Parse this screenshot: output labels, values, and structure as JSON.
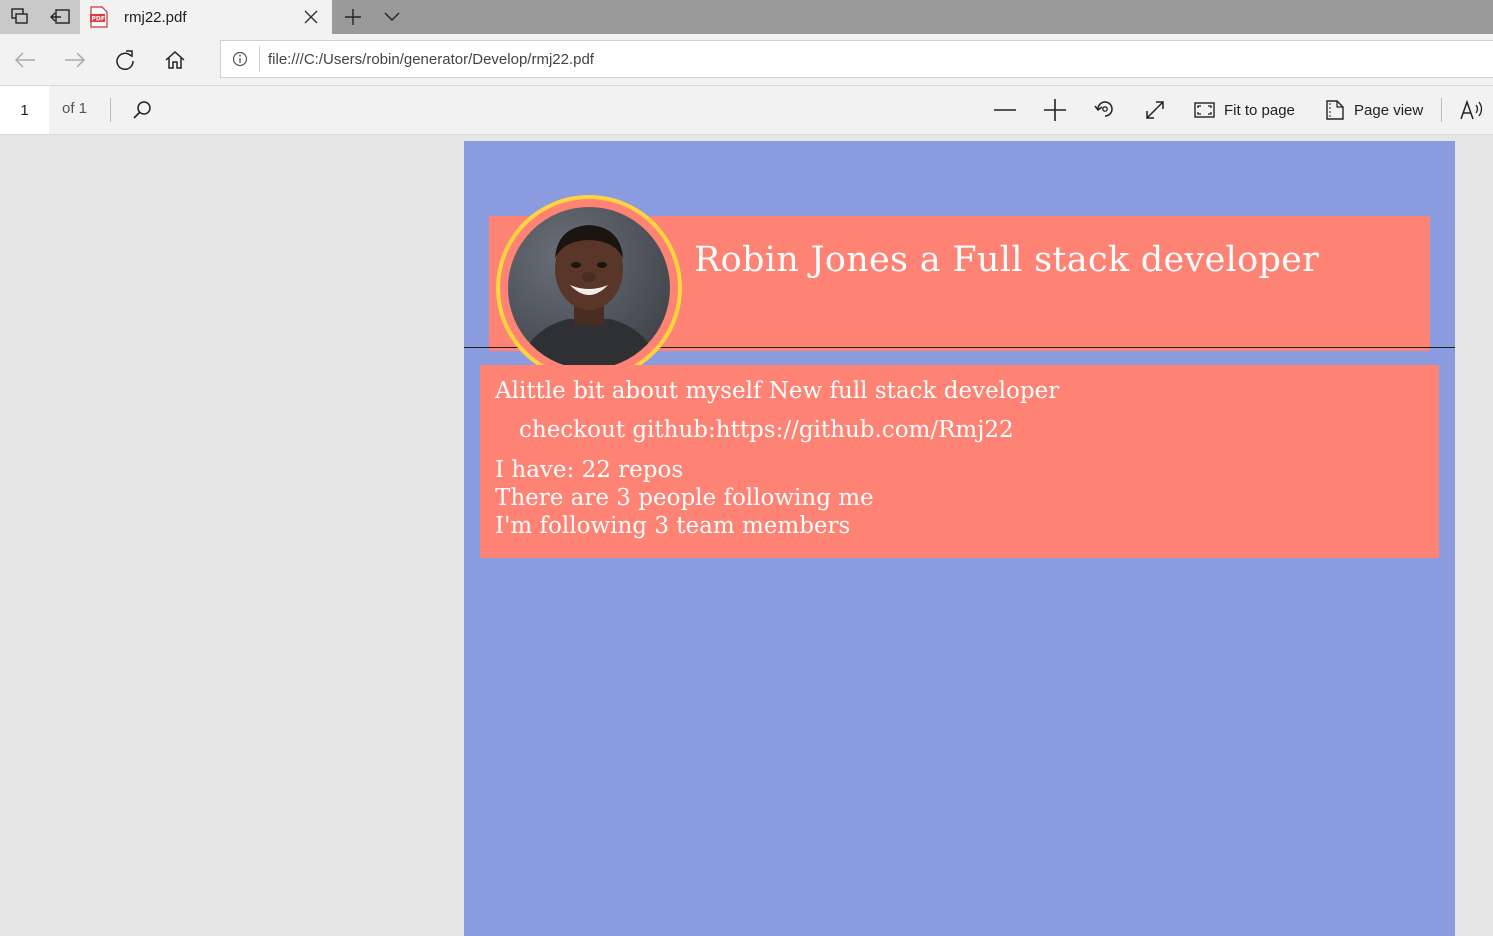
{
  "browser": {
    "tab": {
      "title": "rmj22.pdf",
      "icon": "pdf-file-icon"
    },
    "address": {
      "url": "file:///C:/Users/robin/generator/Develop/rmj22.pdf"
    }
  },
  "pdf_toolbar": {
    "page_number": "1",
    "page_count": "of 1",
    "fit_to_page_label": "Fit to page",
    "page_view_label": "Page view"
  },
  "document": {
    "title": "Robin Jones a Full stack developer",
    "about": "Alittle bit about myself New full stack developer",
    "github": "checkout github:https://github.com/Rmj22",
    "repos": "I have: 22 repos",
    "followers": "There are 3 people following me",
    "following": "I'm following 3 team members"
  },
  "colors": {
    "page_background": "#8a9cdf",
    "card_background": "#ff8374",
    "avatar_ring": "#ffd43f",
    "text": "#ffffff"
  }
}
